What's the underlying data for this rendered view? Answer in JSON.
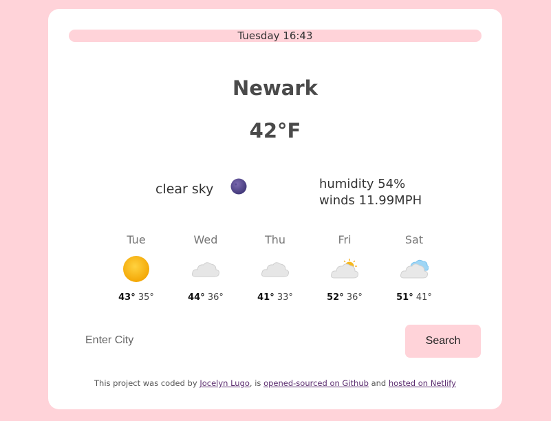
{
  "header": {
    "datetime": "Tuesday 16:43"
  },
  "current": {
    "city": "Newark",
    "temperature": "42°F",
    "description": "clear sky",
    "icon": "night-clear-moon-icon",
    "humidity": "humidity 54%",
    "winds": "winds 11.99MPH"
  },
  "forecast": [
    {
      "day": "Tue",
      "icon": "sun-icon",
      "high": "43°",
      "low": "35°"
    },
    {
      "day": "Wed",
      "icon": "cloud-icon",
      "high": "44°",
      "low": "36°"
    },
    {
      "day": "Thu",
      "icon": "cloud-icon",
      "high": "41°",
      "low": "33°"
    },
    {
      "day": "Fri",
      "icon": "partly-cloudy-icon",
      "high": "52°",
      "low": "36°"
    },
    {
      "day": "Sat",
      "icon": "rain-cloud-icon",
      "high": "51°",
      "low": "41°"
    }
  ],
  "search": {
    "placeholder": "Enter City",
    "button_label": "Search"
  },
  "footer": {
    "prefix": "This project was coded by ",
    "author": "Jocelyn Lugo",
    "mid1": ", is ",
    "github_link": "opened-sourced on Github",
    "mid2": " and ",
    "netlify_link": "hosted on Netlify"
  },
  "colors": {
    "background": "#ffd3d9",
    "card": "#ffffff",
    "accent": "#ffd3d9",
    "link": "#5b2c6f"
  }
}
